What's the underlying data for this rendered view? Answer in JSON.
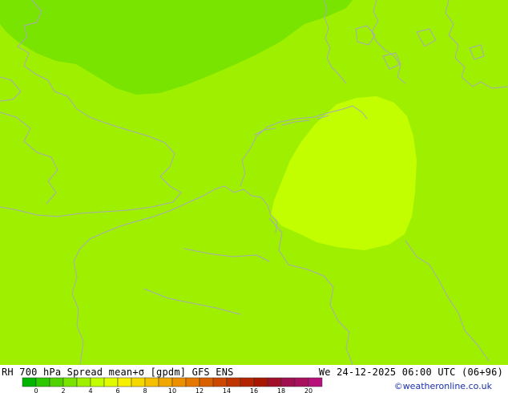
{
  "header": {
    "title_left": "RH 700 hPa Spread mean+σ [gpdm] GFS ENS",
    "title_right": "We 24-12-2025 06:00 UTC (06+96)"
  },
  "credit": "©weatheronline.co.uk",
  "colors": {
    "background_field": "#9ef000",
    "upper_left_zone": "#78e400",
    "central_zone": "#c2fe00",
    "coastline": "#a7a9b8"
  },
  "legend": {
    "labels": [
      "0",
      "2",
      "4",
      "6",
      "8",
      "10",
      "12",
      "14",
      "16",
      "18",
      "20"
    ],
    "colors": [
      "#00b400",
      "#2cc800",
      "#50d200",
      "#78e400",
      "#9ef000",
      "#c2fe00",
      "#e0fa00",
      "#f6f000",
      "#f4d800",
      "#f4c000",
      "#f0a800",
      "#ec9000",
      "#e47800",
      "#d86000",
      "#cc4800",
      "#c03400",
      "#b42400",
      "#a81800",
      "#a01028",
      "#a01050",
      "#a8105e",
      "#b8107a"
    ]
  }
}
